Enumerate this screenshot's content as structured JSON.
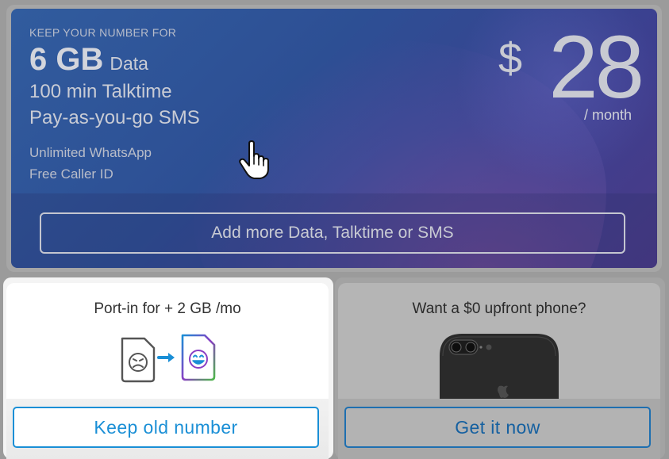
{
  "plan": {
    "eyebrow": "KEEP YOUR NUMBER FOR",
    "data_amount": "6 GB",
    "data_unit": "Data",
    "talktime": "100 min Talktime",
    "sms": "Pay-as-you-go SMS",
    "extras": [
      "Unlimited WhatsApp",
      "Free Caller ID"
    ],
    "price": {
      "currency": "$",
      "amount": "28",
      "period": "/ month"
    },
    "add_more_label": "Add more Data, Talktime or SMS"
  },
  "offers": {
    "port_in": {
      "title": "Port-in for + 2 GB /mo",
      "button_label": "Keep old number",
      "illustration": "sim-swap-sad-to-happy-icon"
    },
    "phone": {
      "title": "Want a $0 upfront phone?",
      "button_label": "Get it now",
      "illustration": "smartphone-image"
    }
  },
  "colors": {
    "accent": "#1a8fd6",
    "plan_gradient_start": "#315c9e",
    "plan_gradient_end": "#4b3a86",
    "backdrop": "#9b9b9b"
  }
}
